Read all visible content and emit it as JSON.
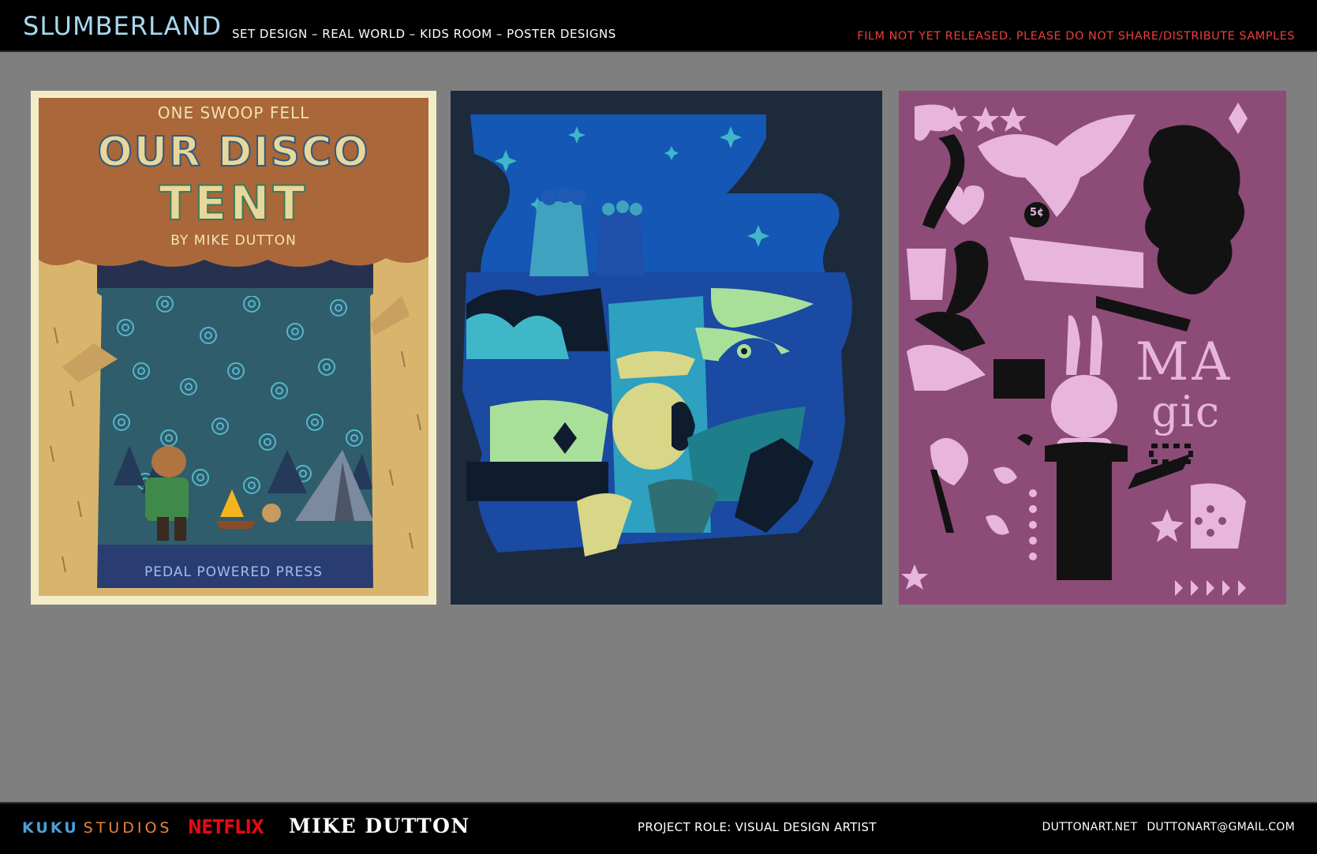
{
  "header": {
    "title": "SLUMBERLAND",
    "subtitle": "SET DESIGN – REAL WORLD –  KIDS ROOM – POSTER DESIGNS",
    "warning": "FILM NOT YET RELEASED. PLEASE DO NOT SHARE/DISTRIBUTE SAMPLES"
  },
  "posters": [
    {
      "top_line": "ONE SWOOP FELL",
      "title_line_1": "OUR DISCO",
      "title_line_2": "TENT",
      "byline": "BY MIKE DUTTON",
      "publisher": "PEDAL POWERED PRESS"
    },
    {},
    {
      "price": "5¢",
      "word_1": "MA",
      "word_2": "gic"
    }
  ],
  "footer": {
    "studio_logo_part1": "KUKU",
    "studio_logo_part2": "STUDIOS",
    "netflix_logo": "NETFLIX",
    "artist": "MIKE DUTTON",
    "role": "PROJECT ROLE: VISUAL DESIGN ARTIST",
    "website": "DUTTONART.NET",
    "email": "DUTTONART@GMAIL.COM"
  },
  "colors": {
    "page_bg": "#7f7f7f",
    "bar_bg": "#000000",
    "title": "#a8d8ee",
    "warning": "#e8413a",
    "poster1_border": "#f3edc7",
    "poster2_bg": "#1c2a3b",
    "poster3_bg": "#8c4c77"
  }
}
